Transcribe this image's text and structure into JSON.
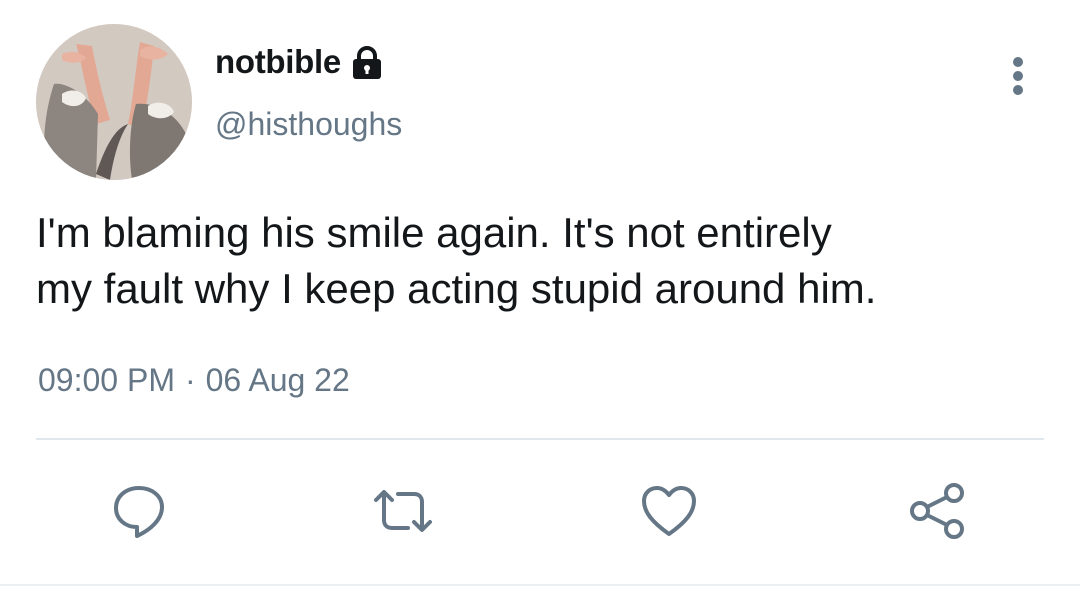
{
  "user": {
    "display_name": "notbible",
    "handle": "@histhoughs",
    "protected": true,
    "avatar_icon": "avatar-photo-icon"
  },
  "tweet": {
    "text": "I'm blaming his smile again. It's not entirely\nmy fault why I keep acting stupid around him.",
    "time": "09:00 PM",
    "separator": "·",
    "date": "06 Aug 22"
  },
  "actions": [
    {
      "name": "reply",
      "icon": "speech-bubble-icon"
    },
    {
      "name": "retweet",
      "icon": "retweet-arrows-icon"
    },
    {
      "name": "like",
      "icon": "heart-icon"
    },
    {
      "name": "share",
      "icon": "share-nodes-icon"
    }
  ],
  "colors": {
    "text": "#14171a",
    "secondary": "#657786",
    "divider": "#e1e8ed",
    "background": "#ffffff"
  }
}
